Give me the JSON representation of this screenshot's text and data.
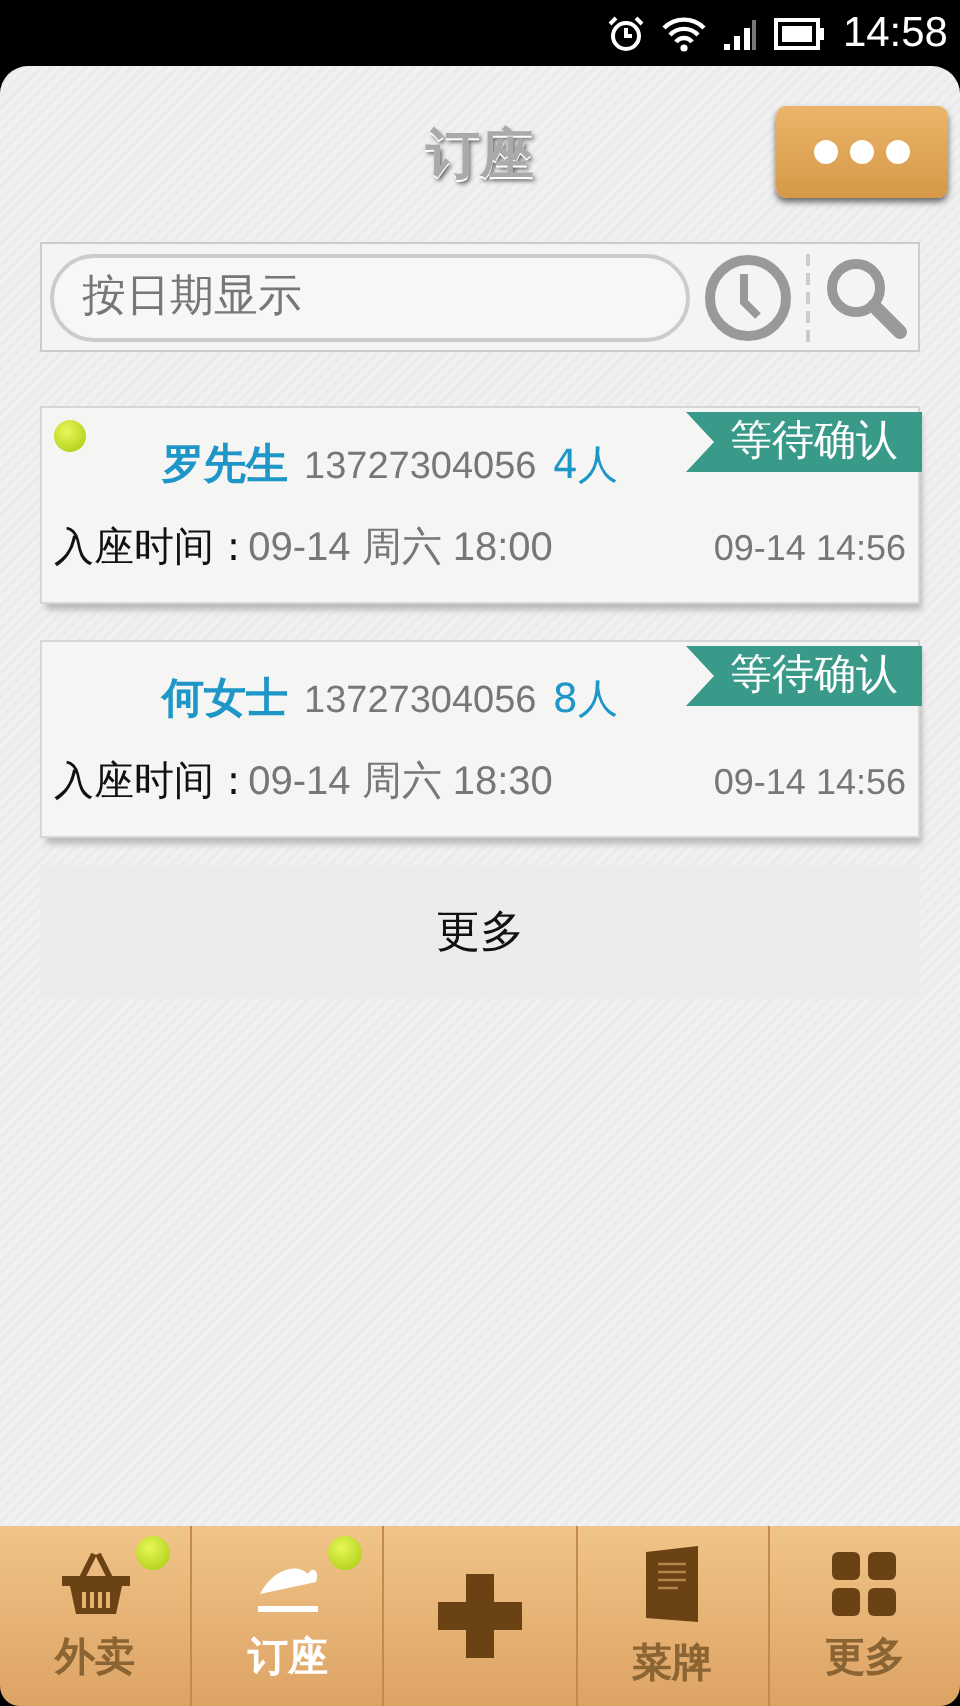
{
  "status_bar": {
    "time": "14:58"
  },
  "header": {
    "title": "订座"
  },
  "search": {
    "placeholder": "按日期显示"
  },
  "reservations": [
    {
      "unread": true,
      "name": "罗先生",
      "phone": "13727304056",
      "party": "4人",
      "status": "等待确认",
      "seat_label": "入座时间 :",
      "seat_time": "09-14 周六 18:00",
      "created": "09-14 14:56"
    },
    {
      "unread": false,
      "name": "何女士",
      "phone": "13727304056",
      "party": "8人",
      "status": "等待确认",
      "seat_label": "入座时间 :",
      "seat_time": "09-14 周六 18:30",
      "created": "09-14 14:56"
    }
  ],
  "more_button": "更多",
  "tabs": [
    {
      "kind": "basket",
      "label": "外卖",
      "selected": false,
      "badge": true
    },
    {
      "kind": "seat",
      "label": "订座",
      "selected": true,
      "badge": true
    },
    {
      "kind": "plus",
      "selected": false,
      "badge": false
    },
    {
      "kind": "menu",
      "label": "菜牌",
      "selected": false,
      "badge": false
    },
    {
      "kind": "grid",
      "label": "更多",
      "selected": false,
      "badge": false
    }
  ]
}
